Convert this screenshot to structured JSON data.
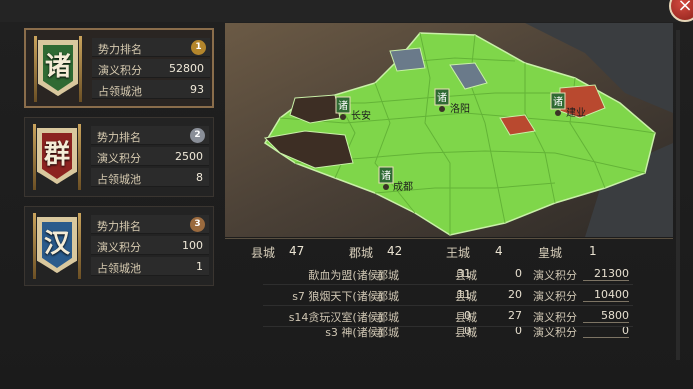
{
  "factions": [
    {
      "emblem_char": "诸",
      "emblem_color": "#2f6a33",
      "active": true,
      "rank_label": "势力排名",
      "rank_badge": "1",
      "rank_badge_color": "#b4862c",
      "score_label": "演义积分",
      "score": "52800",
      "cities_label": "占领城池",
      "cities": "93"
    },
    {
      "emblem_char": "群",
      "emblem_color": "#8c2320",
      "active": false,
      "rank_label": "势力排名",
      "rank_badge": "2",
      "rank_badge_color": "#8a8f98",
      "score_label": "演义积分",
      "score": "2500",
      "cities_label": "占领城池",
      "cities": "8"
    },
    {
      "emblem_char": "汉",
      "emblem_color": "#2a5b8c",
      "active": false,
      "rank_label": "势力排名",
      "rank_badge": "3",
      "rank_badge_color": "#9a6a3e",
      "score_label": "演义积分",
      "score": "100",
      "cities_label": "占领城池",
      "cities": "1"
    }
  ],
  "map": {
    "cities": [
      {
        "name": "长安",
        "flag": "诸"
      },
      {
        "name": "洛阳",
        "flag": "诸"
      },
      {
        "name": "建业",
        "flag": "诸"
      },
      {
        "name": "成都",
        "flag": "诸"
      }
    ],
    "colors": {
      "territory": "#7fd64a",
      "territory_border": "#c9f0a8",
      "enemy_red": "#b9492f",
      "neutral_gray": "#6a7a8a",
      "dark": "#3d2e24",
      "sea": "#3c3f42"
    }
  },
  "summary": {
    "county_label": "县城",
    "county": "47",
    "commandery_label": "郡城",
    "commandery": "42",
    "royal_label": "王城",
    "royal": "4",
    "imperial_label": "皇城",
    "imperial": "1"
  },
  "table": {
    "rows": [
      {
        "name": "歃血为盟(诸侯)",
        "jun_label": "郡城",
        "jun": "31",
        "xian_label": "县城",
        "xian": "0",
        "score_label": "演义积分",
        "score": "21300"
      },
      {
        "name": "s7 狼烟天下(诸侯)",
        "jun_label": "郡城",
        "jun": "11",
        "xian_label": "县城",
        "xian": "20",
        "score_label": "演义积分",
        "score": "10400"
      },
      {
        "name": "s14贪玩汉室(诸侯)",
        "jun_label": "郡城",
        "jun": "0",
        "xian_label": "县城",
        "xian": "27",
        "score_label": "演义积分",
        "score": "5800"
      },
      {
        "name": "s3 神(诸侯)",
        "jun_label": "郡城",
        "jun": "0",
        "xian_label": "县城",
        "xian": "0",
        "score_label": "演义积分",
        "score": "0"
      }
    ]
  },
  "close_glyph": "×"
}
